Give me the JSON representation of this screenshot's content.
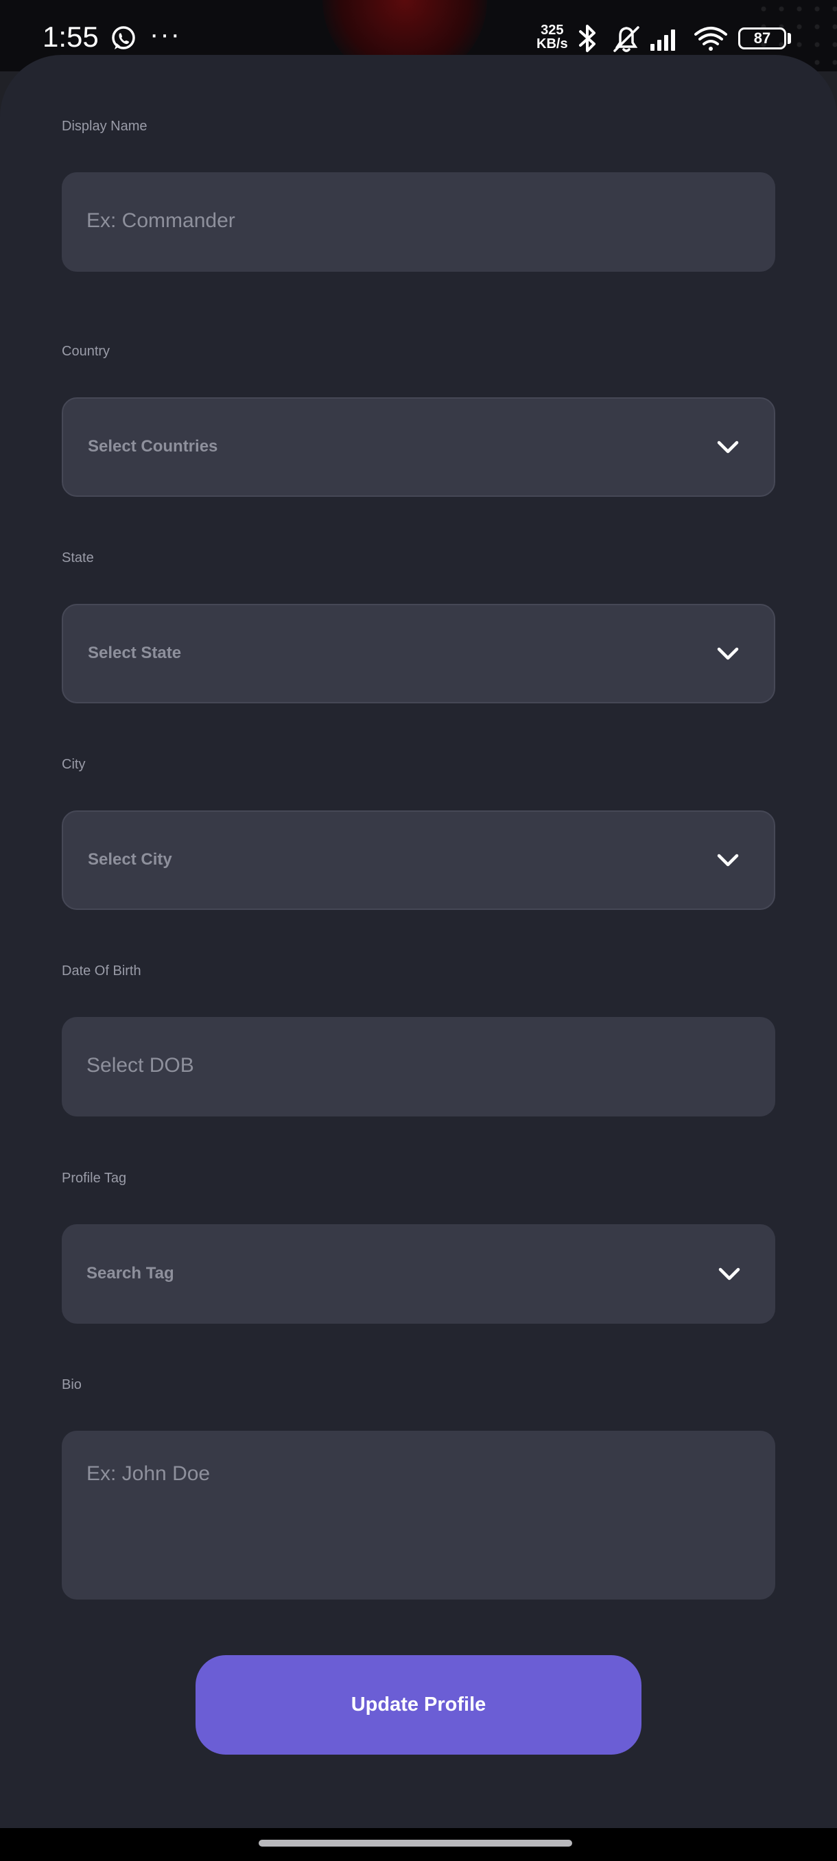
{
  "status_bar": {
    "time": "1:55",
    "speed_value": "325",
    "speed_unit": "KB/s",
    "battery": "87",
    "icons": [
      "whatsapp-icon",
      "more-icon",
      "bluetooth-icon",
      "mute-icon",
      "signal-icon",
      "wifi-icon",
      "battery-icon"
    ]
  },
  "form": {
    "display_name": {
      "label": "Display Name",
      "placeholder": "Ex: Commander"
    },
    "country": {
      "label": "Country",
      "placeholder": "Select Countries"
    },
    "state": {
      "label": "State",
      "placeholder": "Select State"
    },
    "city": {
      "label": "City",
      "placeholder": "Select City"
    },
    "dob": {
      "label": "Date Of Birth",
      "placeholder": "Select DOB"
    },
    "profile_tag": {
      "label": "Profile Tag",
      "placeholder": "Search Tag"
    },
    "bio": {
      "label": "Bio",
      "placeholder": "Ex: John Doe"
    },
    "submit_label": "Update Profile"
  },
  "colors": {
    "background": "#23252f",
    "field": "#383a47",
    "accent": "#6b5ed5",
    "label": "#9a9ca8",
    "placeholder": "#8e909c"
  }
}
